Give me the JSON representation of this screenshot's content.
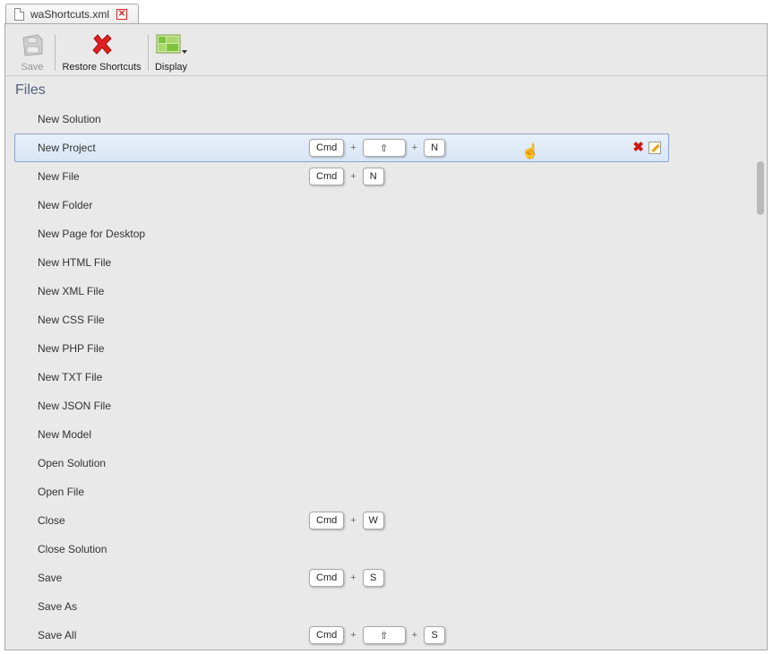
{
  "tab": {
    "title": "waShortcuts.xml"
  },
  "toolbar": {
    "save_label": "Save",
    "restore_label": "Restore Shortcuts",
    "display_label": "Display"
  },
  "section": {
    "title": "Files"
  },
  "rows": [
    {
      "label": "New Solution"
    },
    {
      "label": "New Project",
      "keys": [
        "Cmd",
        "⇧",
        "N"
      ]
    },
    {
      "label": "New File",
      "keys": [
        "Cmd",
        "N"
      ]
    },
    {
      "label": "New Folder"
    },
    {
      "label": "New Page for Desktop"
    },
    {
      "label": "New HTML File"
    },
    {
      "label": "New XML File"
    },
    {
      "label": "New CSS File"
    },
    {
      "label": "New PHP File"
    },
    {
      "label": "New TXT File"
    },
    {
      "label": "New JSON File"
    },
    {
      "label": "New Model"
    },
    {
      "label": "Open Solution"
    },
    {
      "label": "Open File"
    },
    {
      "label": "Close",
      "keys": [
        "Cmd",
        "W"
      ]
    },
    {
      "label": "Close Solution"
    },
    {
      "label": "Save",
      "keys": [
        "Cmd",
        "S"
      ]
    },
    {
      "label": "Save As"
    },
    {
      "label": "Save All",
      "keys": [
        "Cmd",
        "⇧",
        "S"
      ]
    }
  ],
  "key_joiner": "+",
  "selected_row": 1,
  "icons": {
    "tab": "document-icon",
    "tab_close": "close-icon",
    "save": "floppy-disk-icon",
    "restore": "red-x-icon",
    "display": "layout-grid-icon",
    "row_delete": "delete-icon",
    "row_edit": "edit-pencil-icon"
  },
  "colors": {
    "accent": "#52627f",
    "danger": "#d01818",
    "selection": "#d9e6f6"
  }
}
